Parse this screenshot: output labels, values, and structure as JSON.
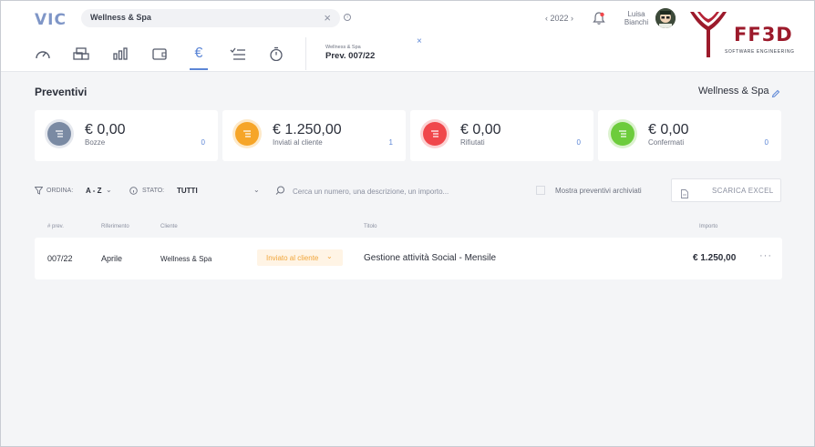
{
  "app": {
    "logo": "VIC"
  },
  "search": {
    "value": "Wellness & Spa"
  },
  "header": {
    "year": "2022",
    "user_first": "Luisa",
    "user_last": "Bianchi"
  },
  "brand": {
    "name": "FF3D",
    "tagline": "SOFTWARE ENGINEERING"
  },
  "nav": {
    "icons": [
      "dashboard-icon",
      "projects-icon",
      "chart-icon",
      "wallet-icon",
      "euro-icon",
      "checklist-icon",
      "timer-icon"
    ],
    "active": "€"
  },
  "doc_tab": {
    "small": "Wellness & Spa",
    "title": "Prev. 007/22",
    "close": "×"
  },
  "page": {
    "title": "Preventivi",
    "client": "Wellness & Spa"
  },
  "cards": [
    {
      "amount": "€ 0,00",
      "label": "Bozze",
      "count": "0",
      "color": "#7a8aa3",
      "ring": "#e5e8ee"
    },
    {
      "amount": "€ 1.250,00",
      "label": "Inviati al cliente",
      "count": "1",
      "color": "#f6a528",
      "ring": "#fde9c9"
    },
    {
      "amount": "€ 0,00",
      "label": "Rifiutati",
      "count": "0",
      "color": "#f0474b",
      "ring": "#fbd3d4"
    },
    {
      "amount": "€ 0,00",
      "label": "Confermati",
      "count": "0",
      "color": "#6dcc3c",
      "ring": "#dcf2cf"
    }
  ],
  "filters": {
    "order_label": "ORDINA:",
    "order_value": "A - Z",
    "state_label": "STATO:",
    "state_value": "TUTTI",
    "search_placeholder": "Cerca un numero, una descrizione, un importo...",
    "archived_label": "Mostra preventivi archiviati",
    "excel_button": "SCARICA EXCEL"
  },
  "table": {
    "headers": [
      "# prev.",
      "Riferimento",
      "Cliente",
      "Titolo",
      "Importo"
    ],
    "rows": [
      {
        "num": "007/22",
        "ref": "Aprile",
        "client": "Wellness & Spa",
        "status": "Inviato al cliente",
        "title": "Gestione attività Social - Mensile",
        "amount": "€ 1.250,00",
        "more": "···"
      }
    ]
  }
}
